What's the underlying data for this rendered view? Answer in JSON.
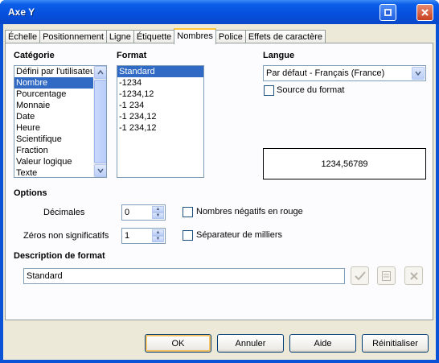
{
  "window": {
    "title": "Axe Y"
  },
  "tabs": [
    "Échelle",
    "Positionnement",
    "Ligne",
    "Étiquette",
    "Nombres",
    "Police",
    "Effets de caractère"
  ],
  "active_tab": "Nombres",
  "category": {
    "label": "Catégorie",
    "items": [
      "Défini par l'utilisateur",
      "Nombre",
      "Pourcentage",
      "Monnaie",
      "Date",
      "Heure",
      "Scientifique",
      "Fraction",
      "Valeur logique",
      "Texte"
    ],
    "selected": "Nombre"
  },
  "format": {
    "label": "Format",
    "items": [
      "Standard",
      "-1234",
      "-1234,12",
      "-1 234",
      "-1 234,12",
      "-1 234,12"
    ],
    "selected": "Standard"
  },
  "language": {
    "label": "Langue",
    "value": "Par défaut - Français (France)",
    "source_format_label": "Source du format"
  },
  "preview": {
    "value": "1234,56789"
  },
  "options": {
    "label": "Options",
    "decimals_label": "Décimales",
    "decimals_value": "0",
    "leading_zeros_label": "Zéros non significatifs",
    "leading_zeros_value": "1",
    "negative_red_label": "Nombres négatifs en rouge",
    "thousands_sep_label": "Séparateur de milliers"
  },
  "format_description": {
    "label": "Description de format",
    "value": "Standard"
  },
  "buttons": {
    "ok": "OK",
    "cancel": "Annuler",
    "help": "Aide",
    "reset": "Réinitialiser"
  },
  "colors": {
    "titlebar": "#0550de",
    "selection": "#316ac5",
    "dialog_bg": "#ece9d8"
  }
}
